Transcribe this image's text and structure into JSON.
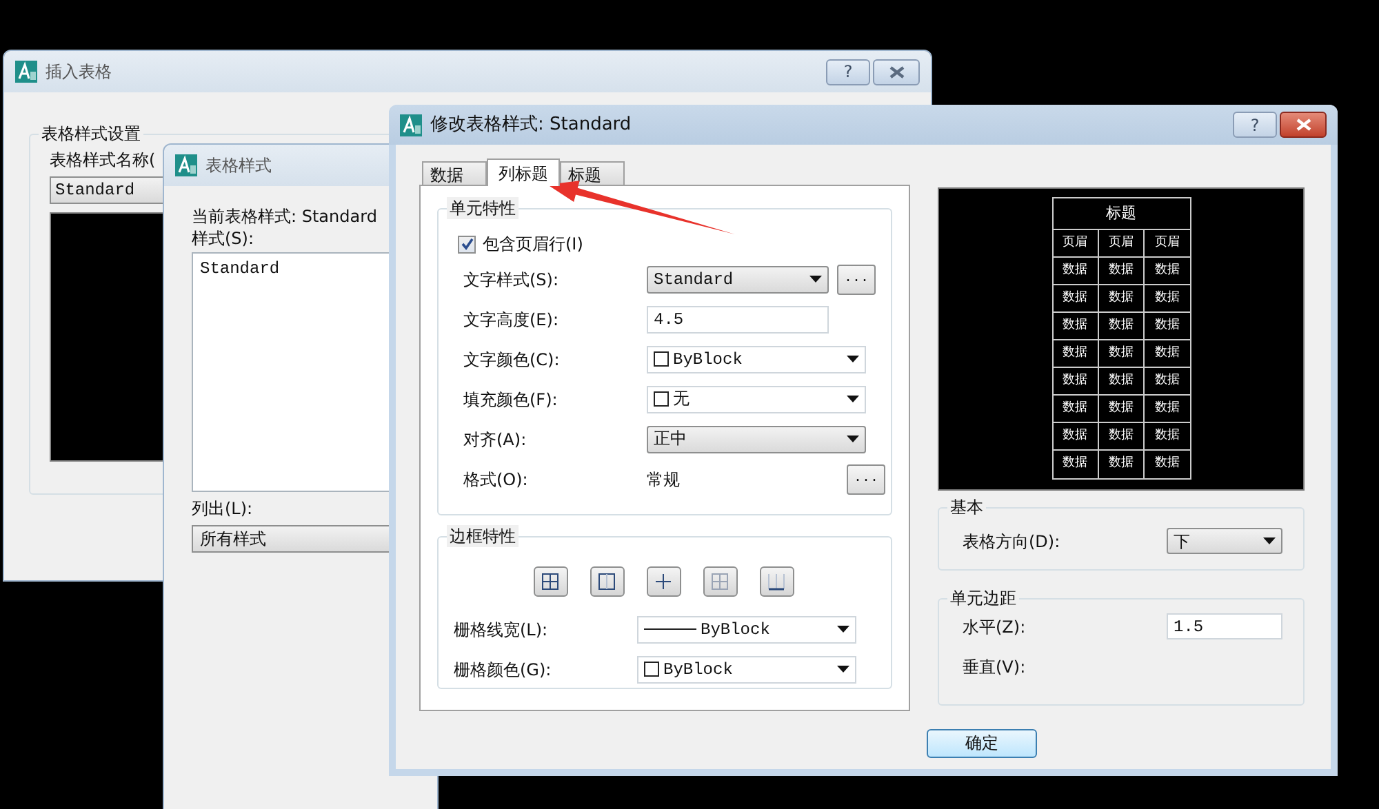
{
  "insert_table_dialog": {
    "title": "插入表格",
    "group_title": "表格样式设置",
    "style_name_label": "表格样式名称(",
    "style_name_value": "Standard"
  },
  "table_style_dialog": {
    "title": "表格样式",
    "current_label": "当前表格样式: Standard",
    "styles_label": "样式(S):",
    "styles": [
      "Standard"
    ],
    "list_label": "列出(L):",
    "list_value": "所有样式"
  },
  "modify_dialog": {
    "title": "修改表格样式: Standard",
    "help_button": "?",
    "tabs": [
      {
        "label": "数据",
        "selected": false
      },
      {
        "label": "列标题",
        "selected": true
      },
      {
        "label": "标题",
        "selected": false
      }
    ],
    "cell_properties": {
      "title": "单元特性",
      "include_header": {
        "label": "包含页眉行(I)",
        "checked": true
      },
      "rows": [
        {
          "kind": "select",
          "label": "文字样式(S):",
          "value": "Standard",
          "browse": "..."
        },
        {
          "kind": "input",
          "label": "文字高度(E):",
          "value": "4.5"
        },
        {
          "kind": "color",
          "label": "文字颜色(C):",
          "value": "ByBlock"
        },
        {
          "kind": "color",
          "label": "填充颜色(F):",
          "value": "无"
        },
        {
          "kind": "select",
          "label": "对齐(A):",
          "value": "正中"
        },
        {
          "kind": "static",
          "label": "格式(O):",
          "value": "常规",
          "browse": "..."
        }
      ]
    },
    "border_properties": {
      "title": "边框特性",
      "buttons": [
        {
          "kind": "all"
        },
        {
          "kind": "outside"
        },
        {
          "kind": "inside"
        },
        {
          "kind": "none"
        },
        {
          "kind": "bottom"
        }
      ],
      "rows": [
        {
          "kind": "lineweight",
          "label": "栅格线宽(L):",
          "value": "ByBlock"
        },
        {
          "kind": "color",
          "label": "栅格颜色(G):",
          "value": "ByBlock"
        }
      ]
    },
    "preview": {
      "title": "标题",
      "header": [
        "页眉",
        "页眉",
        "页眉"
      ],
      "rows": [
        [
          "数据",
          "数据",
          "数据"
        ],
        [
          "数据",
          "数据",
          "数据"
        ],
        [
          "数据",
          "数据",
          "数据"
        ],
        [
          "数据",
          "数据",
          "数据"
        ],
        [
          "数据",
          "数据",
          "数据"
        ],
        [
          "数据",
          "数据",
          "数据"
        ],
        [
          "数据",
          "数据",
          "数据"
        ],
        [
          "数据",
          "数据",
          "数据"
        ]
      ]
    },
    "basic": {
      "title": "基本",
      "label": "表格方向(D):",
      "value": "下"
    },
    "margins": {
      "title": "单元边距",
      "rows": [
        {
          "label": "水平(Z):",
          "value": "1.5"
        },
        {
          "label": "垂直(V):"
        }
      ]
    },
    "ok_button": "确定"
  },
  "annotation": {
    "kind": "arrow"
  }
}
